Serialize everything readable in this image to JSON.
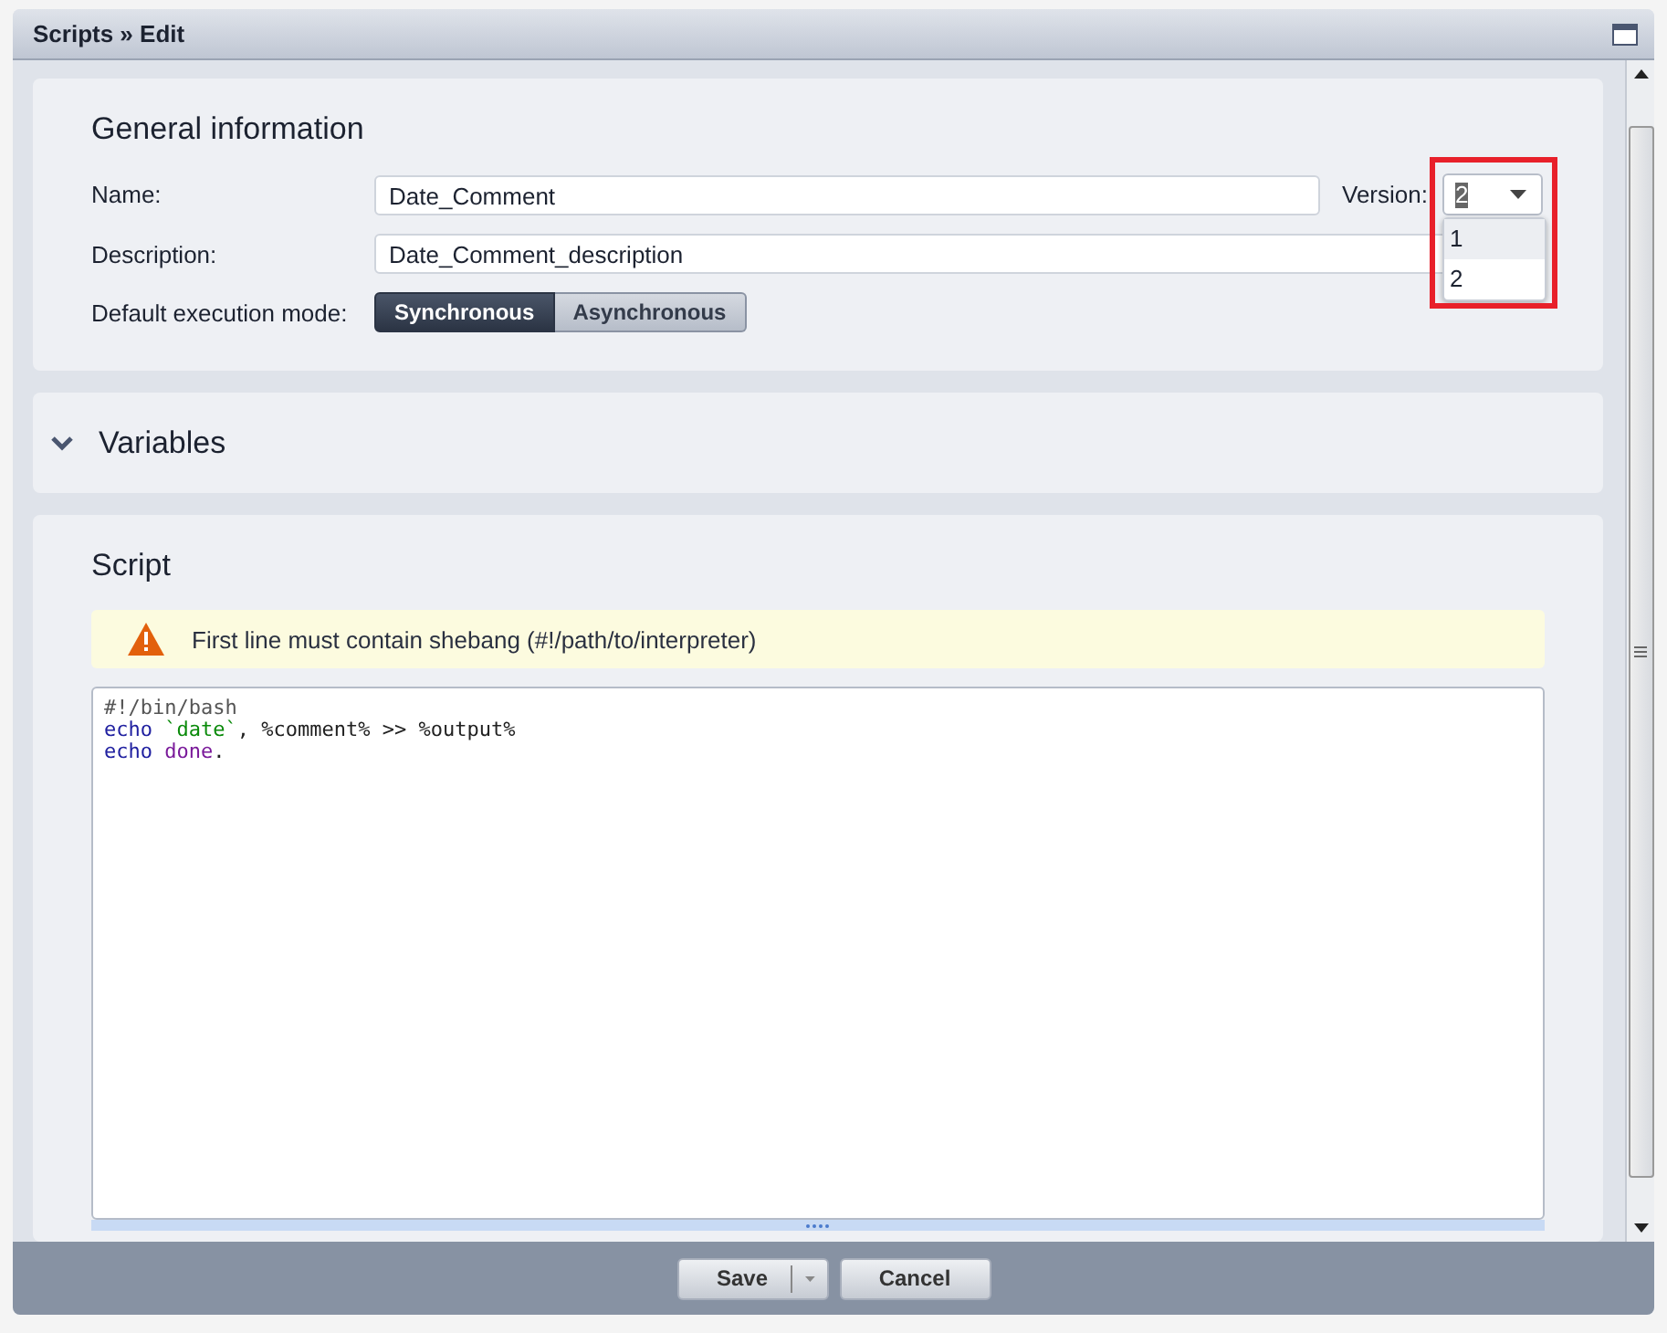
{
  "window": {
    "title": "Scripts » Edit"
  },
  "general": {
    "heading": "General information",
    "name_label": "Name:",
    "name_value": "Date_Comment",
    "version_label": "Version:",
    "version_value": "2",
    "version_options": [
      {
        "label": "1",
        "highlighted": true
      },
      {
        "label": "2",
        "highlighted": false
      }
    ],
    "description_label": "Description:",
    "description_value": "Date_Comment_description",
    "mode_label": "Default execution mode:",
    "modes": [
      {
        "label": "Synchronous",
        "selected": true
      },
      {
        "label": "Asynchronous",
        "selected": false
      }
    ]
  },
  "variables": {
    "heading": "Variables",
    "expanded": false
  },
  "script": {
    "heading": "Script",
    "warning": "First line must contain shebang (#!/path/to/interpreter)",
    "lines": [
      [
        {
          "kind": "comment",
          "text": "#!/bin/bash"
        }
      ],
      [
        {
          "kind": "builtin",
          "text": "echo "
        },
        {
          "kind": "string",
          "text": "`date`"
        },
        {
          "kind": "plain",
          "text": ", %comment% >> %output%"
        }
      ],
      [
        {
          "kind": "builtin",
          "text": "echo "
        },
        {
          "kind": "keyword",
          "text": "done"
        },
        {
          "kind": "plain",
          "text": "."
        }
      ]
    ]
  },
  "footer": {
    "buttons": [
      {
        "label": "Save",
        "kind": "split"
      },
      {
        "label": "Cancel",
        "kind": "plain"
      }
    ]
  }
}
